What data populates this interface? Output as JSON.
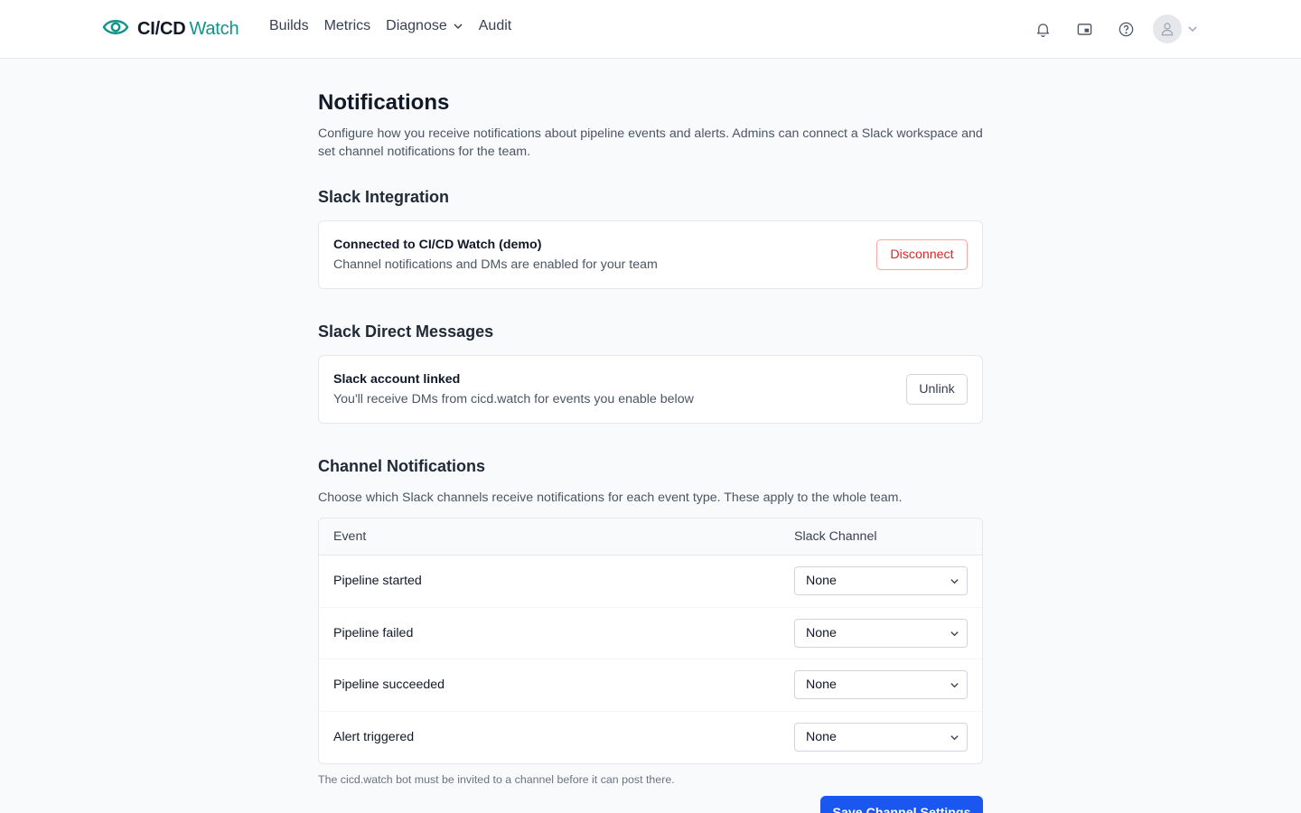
{
  "header": {
    "brand_bold": "CI/CD",
    "brand_light": "Watch",
    "logo_icon": "eye-icon",
    "nav": [
      {
        "label": "Builds"
      },
      {
        "label": "Metrics"
      },
      {
        "label": "Diagnose",
        "dropdown": true
      },
      {
        "label": "Audit"
      }
    ],
    "icons": [
      "bell-icon",
      "picture-in-picture-icon",
      "help-icon",
      "user-icon"
    ]
  },
  "page": {
    "title": "Notifications",
    "description": "Configure how you receive notifications about pipeline events and alerts. Admins can connect a Slack workspace and set channel notifications for the team."
  },
  "slack_integration": {
    "title": "Slack Integration",
    "status_prefix": "Connected to ",
    "workspace": "CI/CD Watch (demo)",
    "subtitle": "Channel notifications and DMs are enabled for your team",
    "button": "Disconnect"
  },
  "slack_dm": {
    "title": "Slack Direct Messages",
    "status": "Slack account linked",
    "subtitle": "You'll receive DMs from cicd.watch for events you enable below",
    "button": "Unlink"
  },
  "channel_notifications": {
    "title": "Channel Notifications",
    "description": "Choose which Slack channels receive notifications for each event type. These apply to the whole team.",
    "columns": [
      "Event",
      "Slack Channel"
    ],
    "rows": [
      {
        "event": "Pipeline started",
        "channel": "None"
      },
      {
        "event": "Pipeline failed",
        "channel": "None"
      },
      {
        "event": "Pipeline succeeded",
        "channel": "None"
      },
      {
        "event": "Alert triggered",
        "channel": "None"
      }
    ],
    "footnote": "The cicd.watch bot must be invited to a channel before it can post there.",
    "save_button": "Save Channel Settings"
  },
  "colors": {
    "brand": "#0f9488",
    "primary": "#1a56f0",
    "danger": "#dc2626"
  }
}
